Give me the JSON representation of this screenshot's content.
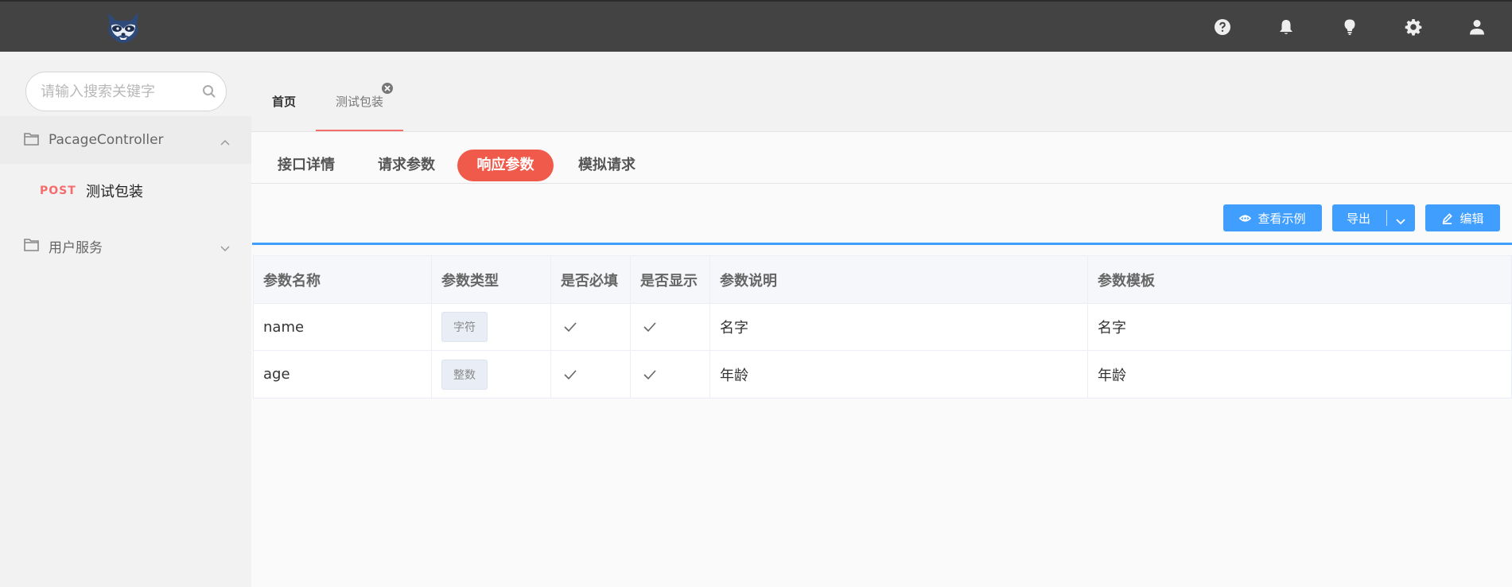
{
  "header": {
    "icons": [
      "help-icon",
      "bell-icon",
      "bulb-icon",
      "gear-icon",
      "user-icon"
    ]
  },
  "sidebar": {
    "search": {
      "placeholder": "请输入搜索关键字",
      "value": ""
    },
    "groups": [
      {
        "label": "PacageController",
        "expanded": true,
        "items": [
          {
            "method": "POST",
            "label": "测试包装"
          }
        ]
      },
      {
        "label": "用户服务",
        "expanded": false
      }
    ]
  },
  "tabs": {
    "home": "首页",
    "active": "测试包装"
  },
  "subtabs": [
    "接口详情",
    "请求参数",
    "响应参数",
    "模拟请求"
  ],
  "toolbar": {
    "view_label": "查看示例",
    "export_label": "导出",
    "edit_label": "编辑"
  },
  "table": {
    "headers": [
      "参数名称",
      "参数类型",
      "是否必填",
      "是否显示",
      "参数说明",
      "参数模板"
    ],
    "rows": [
      {
        "name": "name",
        "type": "字符",
        "required": true,
        "visible": true,
        "desc": "名字",
        "template": "名字"
      },
      {
        "name": "age",
        "type": "整数",
        "required": true,
        "visible": true,
        "desc": "年龄",
        "template": "年龄"
      }
    ]
  },
  "colors": {
    "accent": "#409eff",
    "danger": "#f05a4a",
    "topbar": "#434343"
  }
}
